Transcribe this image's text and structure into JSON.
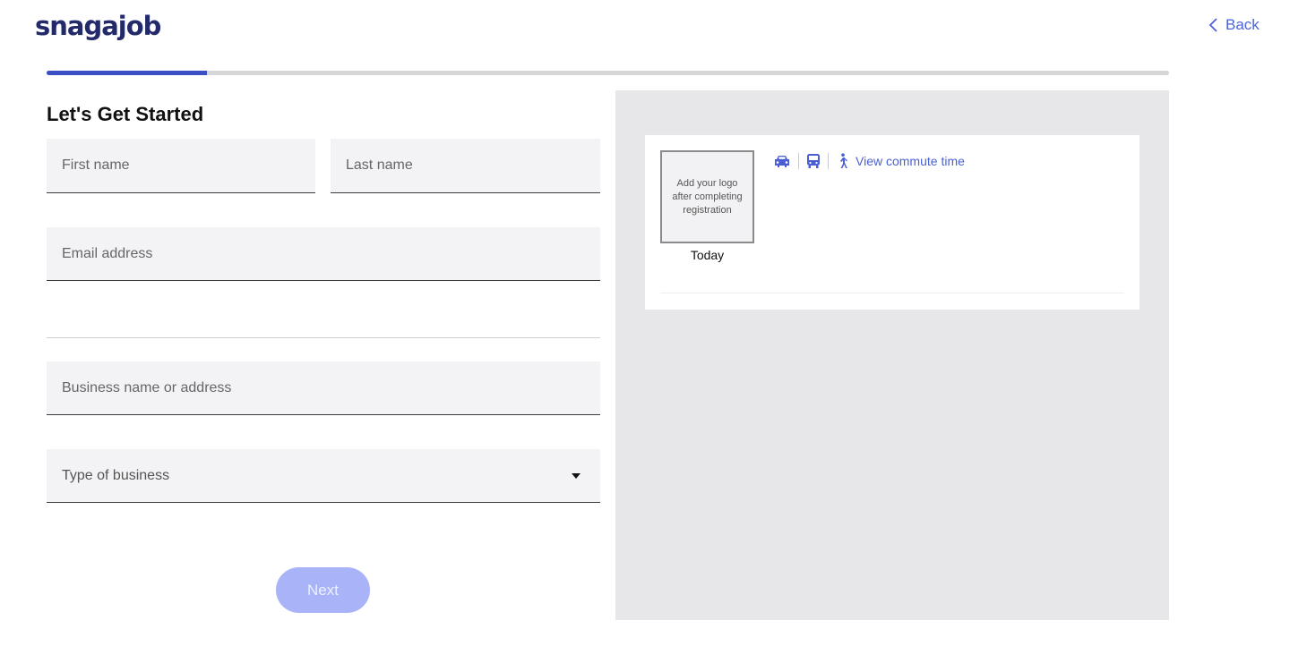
{
  "brand": {
    "logo_text": "snagajob",
    "color": "#232a6b"
  },
  "nav": {
    "back_label": "Back",
    "accent": "#4a63d9"
  },
  "progress": {
    "fraction": 0.143,
    "fill_color": "#3b4fc4"
  },
  "form": {
    "heading": "Let's Get Started",
    "first_name_placeholder": "First name",
    "last_name_placeholder": "Last name",
    "email_placeholder": "Email address",
    "business_placeholder": "Business name or address",
    "business_type_label": "Type of business",
    "next_label": "Next"
  },
  "preview": {
    "logo_placeholder": "Add your logo after completing registration",
    "posted_label": "Today",
    "commute_link": "View commute time",
    "icons": [
      "car-icon",
      "bus-icon",
      "walk-icon"
    ]
  }
}
